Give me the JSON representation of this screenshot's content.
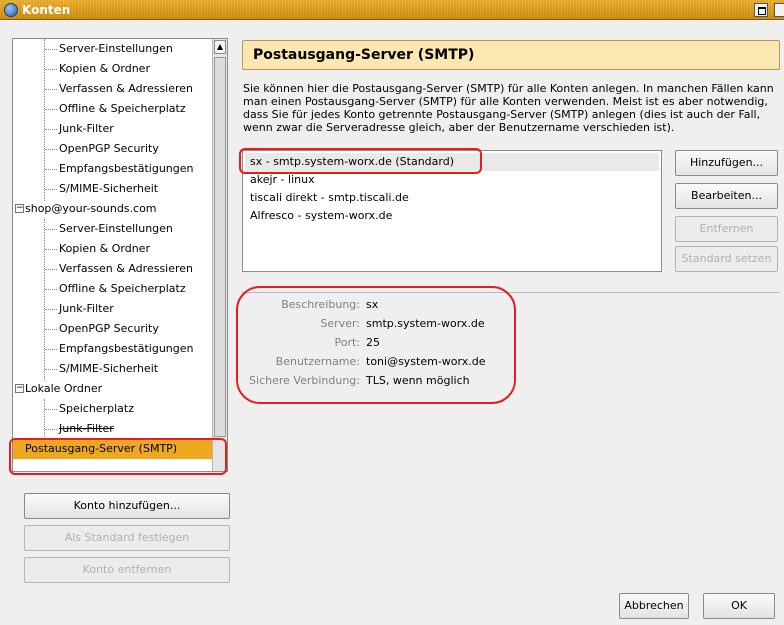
{
  "window": {
    "title": "Konten"
  },
  "tree": {
    "items": [
      {
        "label": "Server-Einstellungen",
        "kind": "child"
      },
      {
        "label": "Kopien & Ordner",
        "kind": "child"
      },
      {
        "label": "Verfassen & Adressieren",
        "kind": "child"
      },
      {
        "label": "Offline & Speicherplatz",
        "kind": "child"
      },
      {
        "label": "Junk-Filter",
        "kind": "child"
      },
      {
        "label": "OpenPGP Security",
        "kind": "child"
      },
      {
        "label": "Empfangsbestätigungen",
        "kind": "child"
      },
      {
        "label": "S/MIME-Sicherheit",
        "kind": "child"
      },
      {
        "label": "shop@your-sounds.com",
        "kind": "parent"
      },
      {
        "label": "Server-Einstellungen",
        "kind": "child"
      },
      {
        "label": "Kopien & Ordner",
        "kind": "child"
      },
      {
        "label": "Verfassen & Adressieren",
        "kind": "child"
      },
      {
        "label": "Offline & Speicherplatz",
        "kind": "child"
      },
      {
        "label": "Junk-Filter",
        "kind": "child"
      },
      {
        "label": "OpenPGP Security",
        "kind": "child"
      },
      {
        "label": "Empfangsbestätigungen",
        "kind": "child"
      },
      {
        "label": "S/MIME-Sicherheit",
        "kind": "child"
      },
      {
        "label": "Lokale Ordner",
        "kind": "parent"
      },
      {
        "label": "Speicherplatz",
        "kind": "child"
      },
      {
        "label": "Junk-Filter",
        "kind": "child"
      },
      {
        "label": "Postausgang-Server (SMTP)",
        "kind": "selected"
      }
    ]
  },
  "left_buttons": {
    "add_account": "Konto hinzufügen...",
    "set_default": "Als Standard festlegen",
    "remove_account": "Konto entfernen"
  },
  "main": {
    "heading": "Postausgang-Server (SMTP)",
    "description_lines": [
      "Sie können hier die Postausgang-Server (SMTP) für alle Konten anlegen. In manchen Fällen kann",
      "man einen Postausgang-Server (SMTP) für alle Konten verwenden. Meist ist es aber notwendig,",
      "dass Sie für jedes Konto getrennte Postausgang-Server (SMTP) anlegen (dies ist auch der Fall,",
      "wenn zwar die Serveradresse gleich, aber der Benutzername verschieden ist)."
    ],
    "servers": [
      "sx - smtp.system-worx.de (Standard)",
      "akejr - linux",
      "tiscali direkt - smtp.tiscali.de",
      "Alfresco - system-worx.de"
    ],
    "buttons": {
      "add": "Hinzufügen...",
      "edit": "Bearbeiten...",
      "remove": "Entfernen",
      "set_default": "Standard setzen"
    },
    "details": {
      "description_label": "Beschreibung:",
      "description_value": "sx",
      "server_label": "Server:",
      "server_value": "smtp.system-worx.de",
      "port_label": "Port:",
      "port_value": "25",
      "username_label": "Benutzername:",
      "username_value": "toni@system-worx.de",
      "security_label": "Sichere Verbindung:",
      "security_value": "TLS, wenn möglich"
    }
  },
  "footer": {
    "cancel": "Abbrechen",
    "ok": "OK"
  },
  "colors": {
    "title_bar": "#d9960f",
    "selection": "#eea820",
    "annotation": "#e61d1d",
    "header_bg": "#fce6b2"
  }
}
